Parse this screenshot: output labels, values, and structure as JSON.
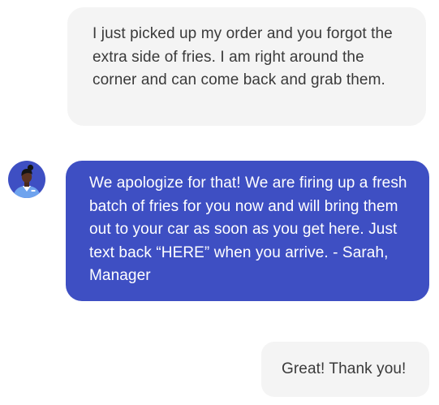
{
  "conversation": {
    "messages": [
      {
        "sender": "customer",
        "text": "I just picked up my order and you forgot the extra side of fries. I am right around the corner and can come back and grab them."
      },
      {
        "sender": "restaurant",
        "text": "We apologize for that! We are firing up a fresh batch of fries for you now and will bring them out to your car as soon as you get here. Just text back “HERE” when you arrive.  - Sarah, Manager"
      },
      {
        "sender": "customer",
        "text": "Great! Thank you!"
      }
    ],
    "agent_avatar": {
      "icon": "agent-avatar-icon"
    }
  },
  "colors": {
    "customer_bubble": "#f4f4f4",
    "customer_text": "#3a3a3a",
    "agent_bubble": "#3e4fc3",
    "agent_text": "#ffffff",
    "avatar_bg": "#3e4fc3"
  }
}
